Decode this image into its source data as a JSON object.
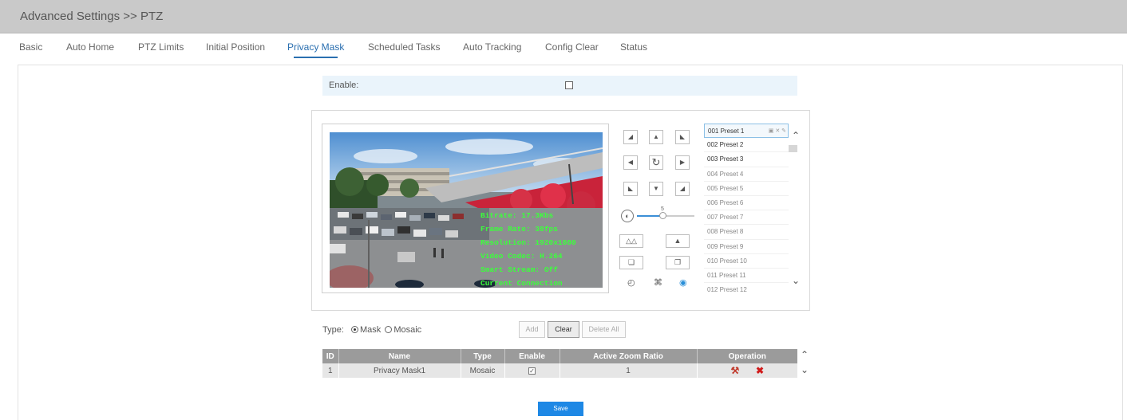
{
  "header": {
    "title": "Advanced Settings >> PTZ"
  },
  "tabs": [
    {
      "label": "Basic"
    },
    {
      "label": "Auto Home"
    },
    {
      "label": "PTZ Limits"
    },
    {
      "label": "Initial Position"
    },
    {
      "label": "Privacy Mask"
    },
    {
      "label": "Scheduled Tasks"
    },
    {
      "label": "Auto Tracking"
    },
    {
      "label": "Config Clear"
    },
    {
      "label": "Status"
    }
  ],
  "active_tab": "Privacy Mask",
  "enable": {
    "label": "Enable:",
    "checked": false
  },
  "osd": {
    "bitrate": "Bitrate: 17.3Kbs",
    "frame_rate": "Frame Rate: 38fps",
    "resolution": "Resolution: 1920x1080",
    "codec": "Video Codec: H.264",
    "smart_stream": "Smart Stream: Off",
    "connection": "Current Connection"
  },
  "ptz": {
    "speed_value": "5",
    "speed_level": 0.45
  },
  "presets": [
    {
      "label": "001 Preset 1"
    },
    {
      "label": "002 Preset 2"
    },
    {
      "label": "003 Preset 3"
    },
    {
      "label": "004 Preset 4"
    },
    {
      "label": "005 Preset 5"
    },
    {
      "label": "006 Preset 6"
    },
    {
      "label": "007 Preset 7"
    },
    {
      "label": "008 Preset 8"
    },
    {
      "label": "009 Preset 9"
    },
    {
      "label": "010 Preset 10"
    },
    {
      "label": "011 Preset 11"
    },
    {
      "label": "012 Preset 12"
    }
  ],
  "type_row": {
    "label": "Type:",
    "mask": "Mask",
    "mosaic": "Mosaic",
    "selected": "Mask"
  },
  "buttons": {
    "add": "Add",
    "clear": "Clear",
    "delete_all": "Delete All",
    "save": "Save"
  },
  "table": {
    "headers": [
      "ID",
      "Name",
      "Type",
      "Enable",
      "Active Zoom Ratio",
      "Operation"
    ],
    "rows": [
      {
        "id": "1",
        "name": "Privacy Mask1",
        "type": "Mosaic",
        "enable": true,
        "zoom": "1"
      }
    ]
  },
  "colors": {
    "accent": "#1e88e5",
    "tab_active": "#2a6fb0",
    "header_bg": "#c9c9c9",
    "table_header": "#9b9b9b",
    "osd": "#3cff3c",
    "delete": "#d11a1a"
  }
}
